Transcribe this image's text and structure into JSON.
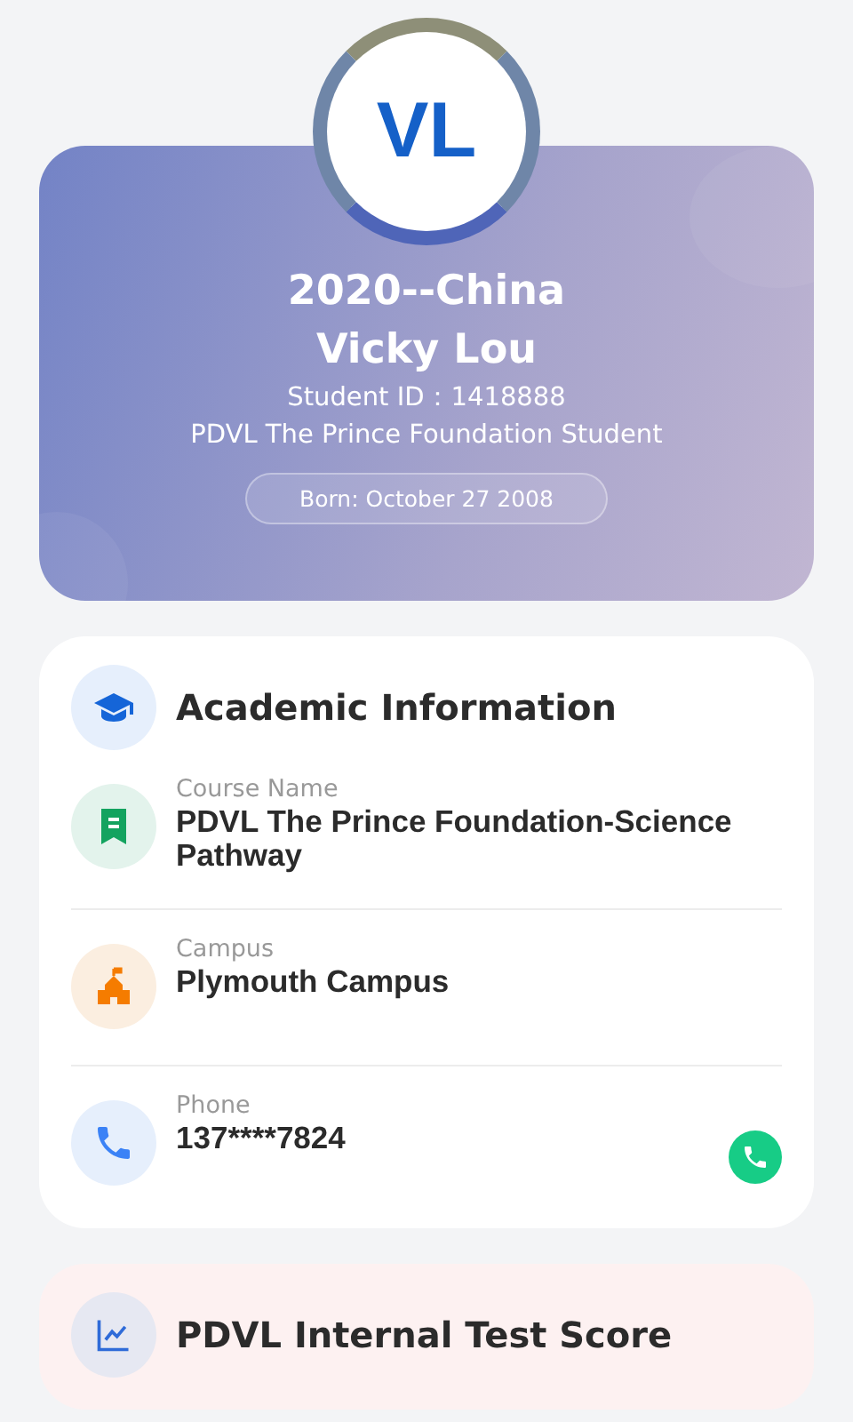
{
  "profile": {
    "initials": "VL",
    "cohort": "2020--China",
    "name": "Vicky Lou",
    "student_id": "Student ID：1418888",
    "program": "PDVL The Prince Foundation Student",
    "born": "Born: October 27 2008"
  },
  "academic": {
    "title": "Academic Information",
    "fields": [
      {
        "kind": "course",
        "label": "Course Name",
        "value": "PDVL The Prince Foundation-Science Pathway"
      },
      {
        "kind": "campus",
        "label": "Campus",
        "value": "Plymouth Campus"
      },
      {
        "kind": "phone",
        "label": "Phone",
        "value": "137****7824"
      }
    ]
  },
  "scores": {
    "title": "PDVL Internal Test Score"
  }
}
